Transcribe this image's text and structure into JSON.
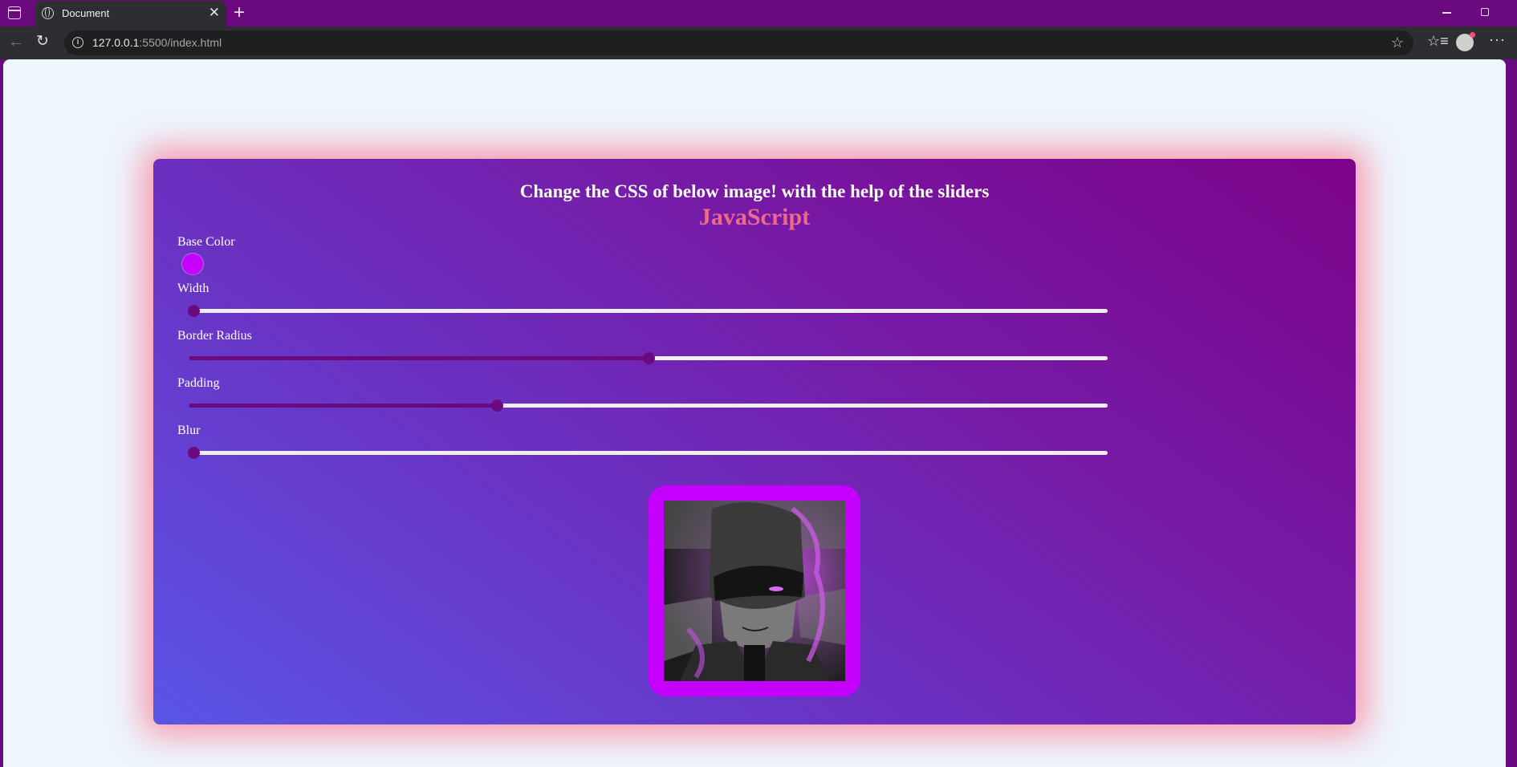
{
  "browser": {
    "tab_title": "Document",
    "tab_close": "✕",
    "new_tab": "+",
    "url_host": "127.0.0.1",
    "url_rest": ":5500/index.html",
    "icons": [
      "tab-actions-icon",
      "globe-icon",
      "close-icon",
      "new-tab-icon",
      "minimize-icon",
      "maximize-icon",
      "back-icon",
      "reload-icon",
      "info-icon",
      "star-icon",
      "favorites-icon",
      "profile-icon",
      "more-icon"
    ]
  },
  "page": {
    "heading": "Change the CSS of below image! with the help of the sliders",
    "subheading": "JavaScript",
    "controls": {
      "base_color": {
        "label": "Base Color",
        "value": "#c500ff"
      },
      "width": {
        "label": "Width",
        "value_percent": 0
      },
      "border_radius": {
        "label": "Border Radius",
        "value_percent": 50
      },
      "padding": {
        "label": "Padding",
        "value_percent": 33.5
      },
      "blur": {
        "label": "Blur",
        "value_percent": 0
      }
    },
    "colors": {
      "accent": "#6b0a7e",
      "subheading": "#ed6a8c",
      "frame": "#c500ff",
      "glow": "#ff506e"
    }
  }
}
